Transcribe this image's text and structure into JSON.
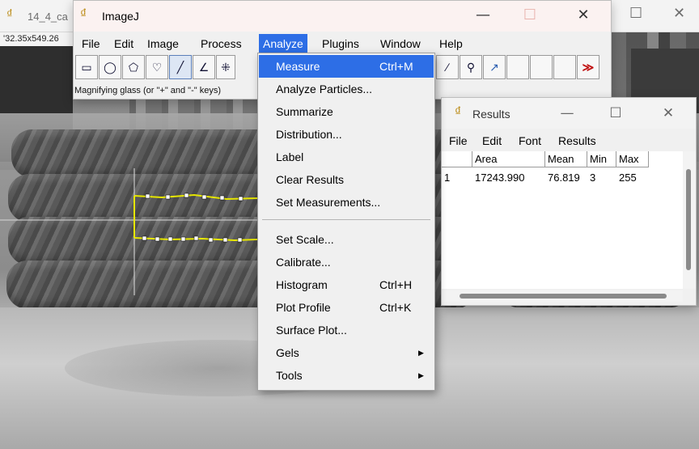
{
  "background_window": {
    "title": "14_4_ca",
    "subtitle": "'32.35x549.26",
    "icon": "imagej-microscope-icon"
  },
  "imagej": {
    "title": "ImageJ",
    "window_buttons": {
      "minimize": "—",
      "maximize": "☐",
      "close": "✕"
    },
    "menu": [
      "File",
      "Edit",
      "Image",
      "Process",
      "Analyze",
      "Plugins",
      "Window",
      "Help"
    ],
    "active_menu": "Analyze",
    "status_text": "Magnifying glass (or \"+\" and \"-\" keys)",
    "tools": [
      {
        "name": "rectangle-tool",
        "glyph": "▭"
      },
      {
        "name": "oval-tool",
        "glyph": "◯"
      },
      {
        "name": "polygon-tool",
        "glyph": "⬠"
      },
      {
        "name": "freehand-tool",
        "glyph": "♡"
      },
      {
        "name": "line-tool",
        "glyph": "╱"
      },
      {
        "name": "angle-tool",
        "glyph": "∠"
      },
      {
        "name": "point-tool",
        "glyph": "⁜"
      }
    ],
    "tools_right": [
      {
        "name": "brush-tool",
        "glyph": "∕"
      },
      {
        "name": "dropper-tool",
        "glyph": "⚲"
      },
      {
        "name": "arrow-tool",
        "glyph": "↗"
      },
      {
        "name": "more-tools",
        "glyph": "≫"
      }
    ]
  },
  "analyze_menu": {
    "items": [
      {
        "label": "Measure",
        "shortcut": "Ctrl+M",
        "highlighted": true
      },
      {
        "label": "Analyze Particles...",
        "shortcut": ""
      },
      {
        "label": "Summarize",
        "shortcut": ""
      },
      {
        "label": "Distribution...",
        "shortcut": ""
      },
      {
        "label": "Label",
        "shortcut": ""
      },
      {
        "label": "Clear Results",
        "shortcut": ""
      },
      {
        "label": "Set Measurements...",
        "shortcut": ""
      }
    ],
    "items2": [
      {
        "label": "Set Scale...",
        "shortcut": ""
      },
      {
        "label": "Calibrate...",
        "shortcut": ""
      },
      {
        "label": "Histogram",
        "shortcut": "Ctrl+H"
      },
      {
        "label": "Plot Profile",
        "shortcut": "Ctrl+K"
      },
      {
        "label": "Surface Plot...",
        "shortcut": ""
      },
      {
        "label": "Gels",
        "shortcut": "",
        "submenu": true
      },
      {
        "label": "Tools",
        "shortcut": "",
        "submenu": true
      }
    ]
  },
  "results": {
    "title": "Results",
    "menu": [
      "File",
      "Edit",
      "Font",
      "Results"
    ],
    "columns": [
      "",
      "Area",
      "Mean",
      "Min",
      "Max"
    ],
    "rows": [
      [
        "1",
        "17243.990",
        "76.819",
        "3",
        "255"
      ]
    ]
  },
  "colors": {
    "highlight": "#2d6ee6",
    "selection_line": "#e6e600"
  }
}
